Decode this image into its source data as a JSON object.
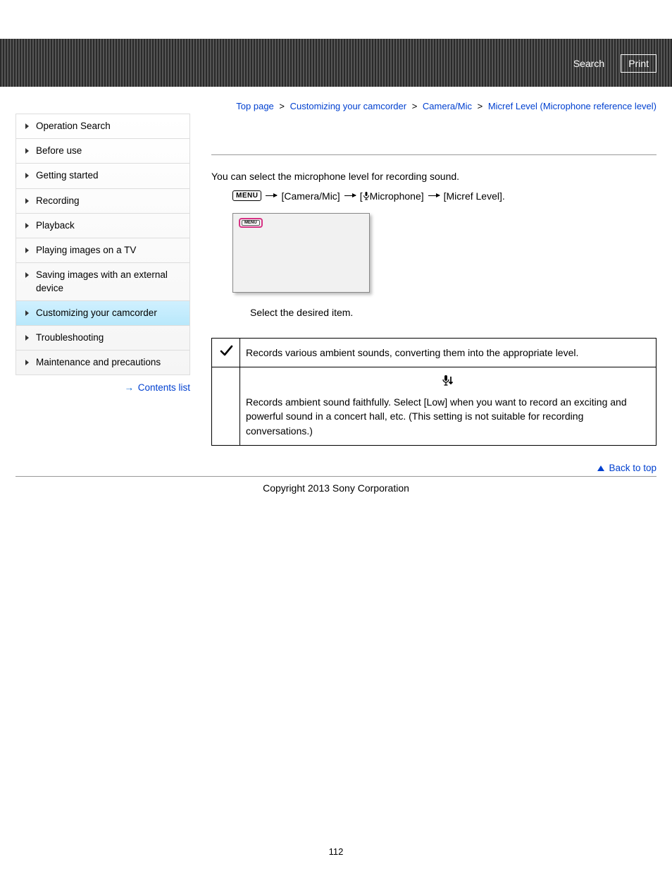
{
  "topbar": {
    "search_label": "Search",
    "print_label": "Print"
  },
  "sidebar": {
    "items": [
      {
        "label": "Operation Search",
        "active": false
      },
      {
        "label": "Before use",
        "active": false
      },
      {
        "label": "Getting started",
        "active": false
      },
      {
        "label": "Recording",
        "active": false
      },
      {
        "label": "Playback",
        "active": false
      },
      {
        "label": "Playing images on a TV",
        "active": false
      },
      {
        "label": "Saving images with an external device",
        "active": false
      },
      {
        "label": "Customizing your camcorder",
        "active": true
      },
      {
        "label": "Troubleshooting",
        "active": false
      },
      {
        "label": "Maintenance and precautions",
        "active": false
      }
    ],
    "contents_link": "Contents list"
  },
  "breadcrumb": {
    "items": [
      "Top page",
      "Customizing your camcorder",
      "Camera/Mic",
      "Micref Level (Microphone reference level)"
    ],
    "sep": ">"
  },
  "content": {
    "intro": "You can select the microphone level for recording sound.",
    "menu_badge": "MENU",
    "menu_path": [
      "[Camera/Mic]",
      "[",
      "Microphone]",
      "[Micref Level]."
    ],
    "screen_chip": "MENU",
    "step": "Select the desired item.",
    "options": [
      {
        "icon": "check",
        "desc_top": "",
        "desc": "Records various ambient sounds, converting them into the appropriate level."
      },
      {
        "icon": "mic-low",
        "desc_top": "",
        "desc": "Records ambient sound faithfully. Select [Low] when you want to record an exciting and powerful sound in a concert hall, etc. (This setting is not suitable for recording conversations.)"
      }
    ],
    "backtop": "Back to top"
  },
  "footer": {
    "copyright": "Copyright 2013 Sony Corporation",
    "pagenum": "112"
  }
}
